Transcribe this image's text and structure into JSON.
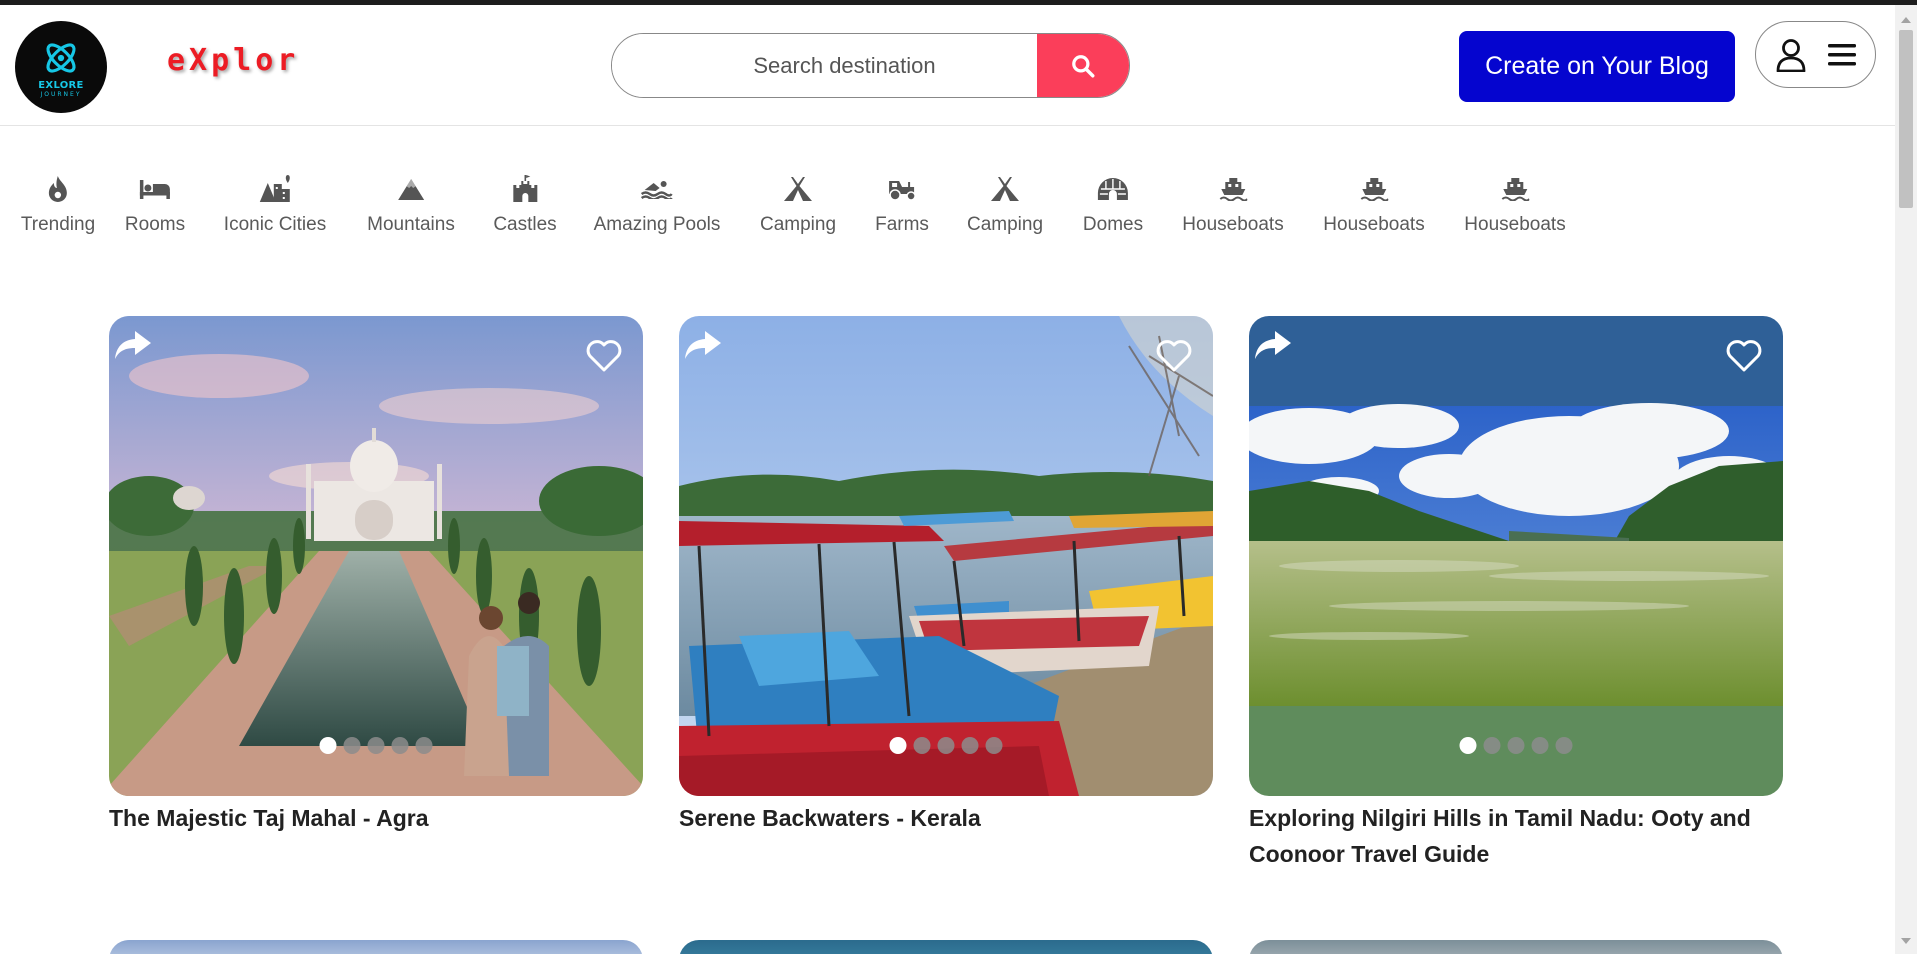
{
  "header": {
    "logo_text": "EXLORE",
    "logo_subtext": "JOURNEY",
    "brand": "eXplor",
    "search": {
      "placeholder": "Search destination",
      "value": ""
    },
    "cta_label": "Create on Your Blog",
    "colors": {
      "brand": "#ec1c24",
      "search_button": "#fb3e5a",
      "cta": "#0505cf",
      "logo_accent": "#16c7e6"
    }
  },
  "categories": [
    {
      "label": "Trending",
      "icon": "fire-icon"
    },
    {
      "label": "Rooms",
      "icon": "bed-icon"
    },
    {
      "label": "Iconic Cities",
      "icon": "city-icon"
    },
    {
      "label": "Mountains",
      "icon": "mountain-icon"
    },
    {
      "label": "Castles",
      "icon": "castle-icon"
    },
    {
      "label": "Amazing Pools",
      "icon": "swimmer-icon"
    },
    {
      "label": "Camping",
      "icon": "tent-icon"
    },
    {
      "label": "Farms",
      "icon": "tractor-icon"
    },
    {
      "label": "Camping",
      "icon": "tent-icon"
    },
    {
      "label": "Domes",
      "icon": "igloo-icon"
    },
    {
      "label": "Houseboats",
      "icon": "ship-icon"
    },
    {
      "label": "Houseboats",
      "icon": "ship-icon"
    },
    {
      "label": "Houseboats",
      "icon": "ship-icon"
    }
  ],
  "cards": [
    {
      "title": "The Majestic Taj Mahal - Agra",
      "image": "taj-mahal-photo",
      "slides": 5,
      "active_slide": 1
    },
    {
      "title": "Serene Backwaters - Kerala",
      "image": "pedal-boats-lake-photo",
      "slides": 5,
      "active_slide": 1
    },
    {
      "title": "Exploring Nilgiri Hills in Tamil Nadu: Ooty and Coonoor Travel Guide",
      "image": "nilgiri-lake-photo",
      "slides": 5,
      "active_slide": 1
    }
  ]
}
